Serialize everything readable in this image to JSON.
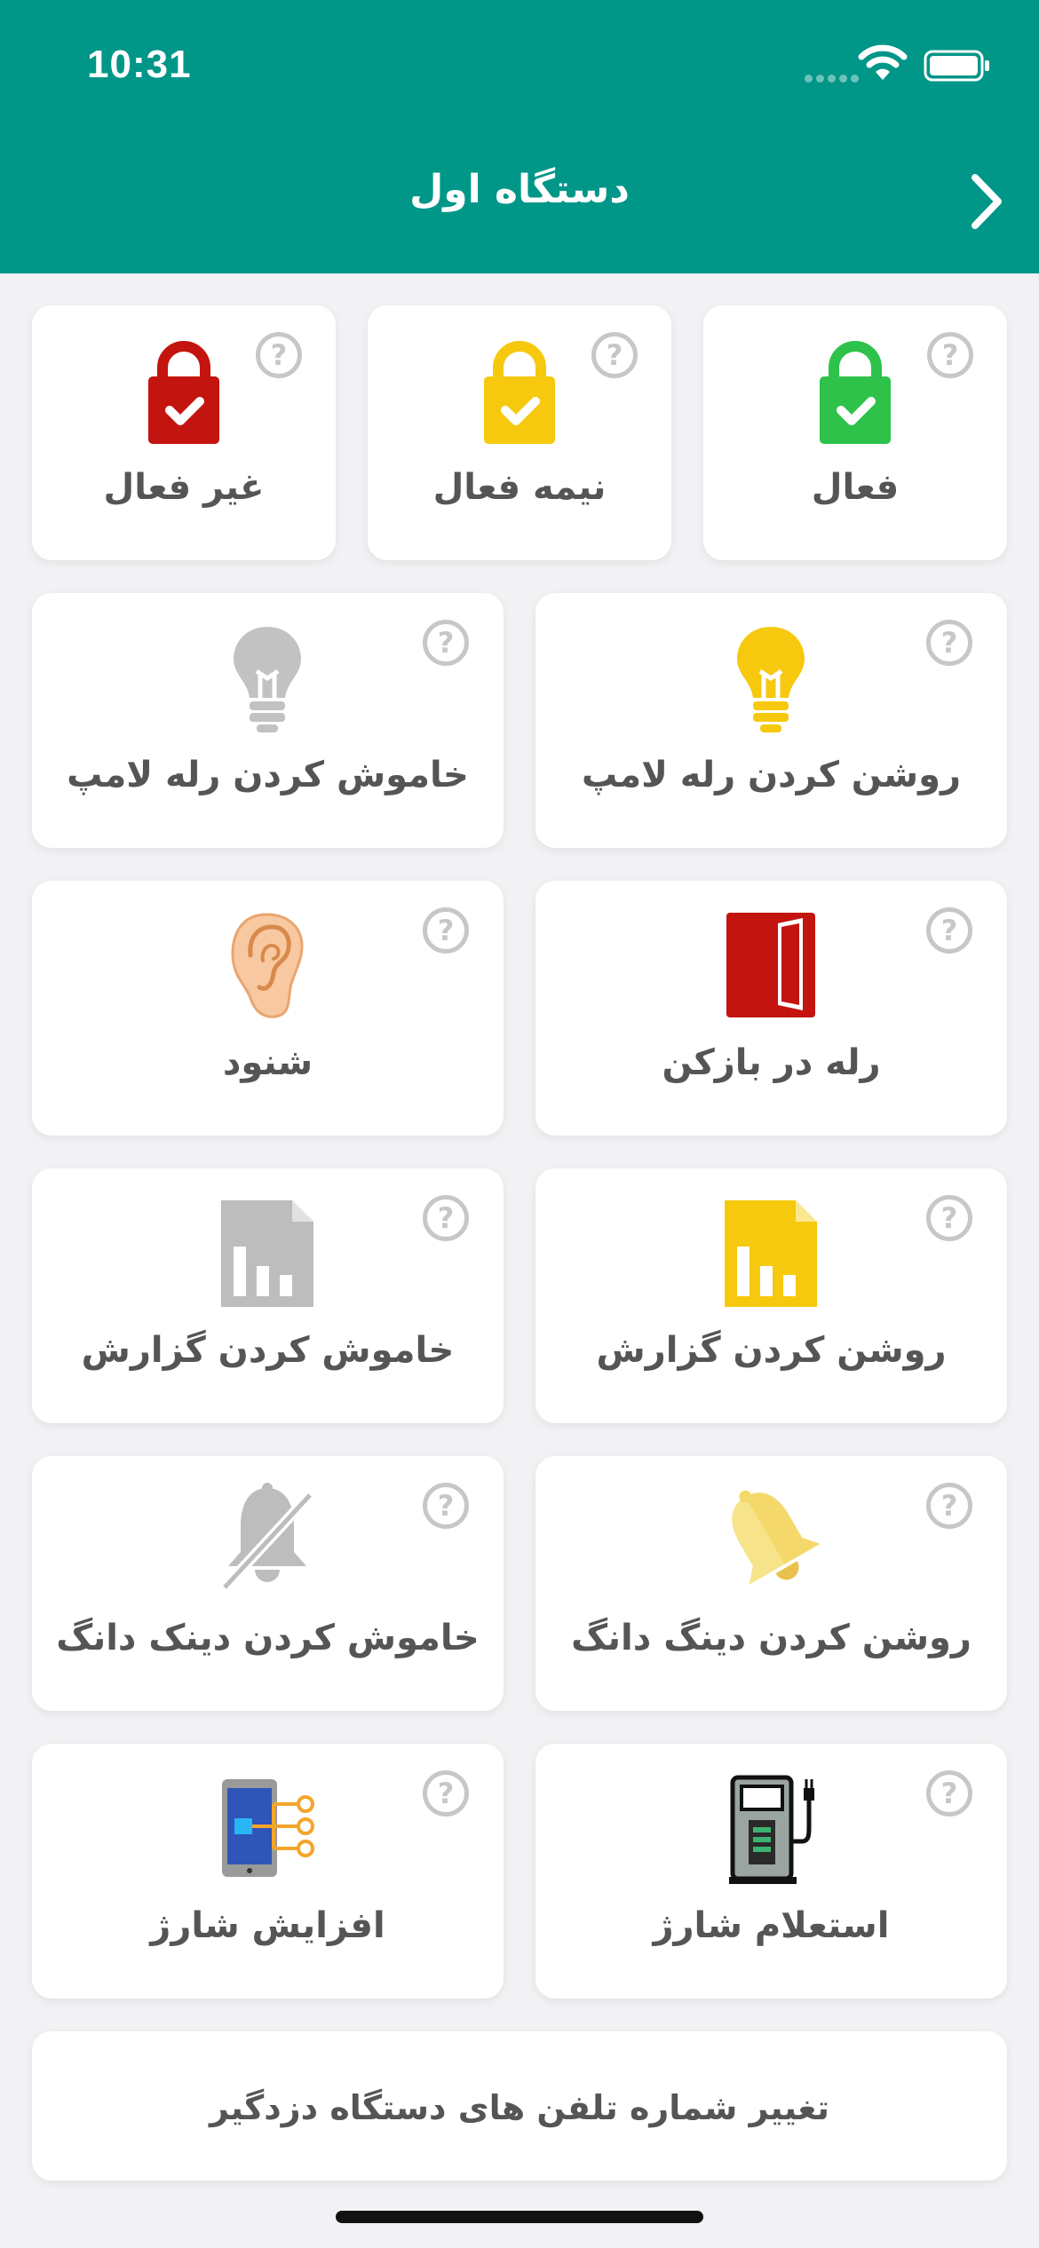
{
  "status": {
    "time": "10:31"
  },
  "header": {
    "title": "دستگاه اول"
  },
  "help_glyph": "?",
  "modes": [
    {
      "label": "فعال",
      "color": "#2ec24a"
    },
    {
      "label": "نیمه فعال",
      "color": "#f6c90e"
    },
    {
      "label": "غیر فعال",
      "color": "#c4140f"
    }
  ],
  "actions": [
    {
      "label": "روشن کردن رله لامپ",
      "icon": "lightbulb-on-icon"
    },
    {
      "label": "خاموش کردن رله لامپ",
      "icon": "lightbulb-off-icon"
    },
    {
      "label": "رله در بازکن",
      "icon": "door-icon"
    },
    {
      "label": "شنود",
      "icon": "ear-icon"
    },
    {
      "label": "روشن کردن گزارش",
      "icon": "report-on-icon"
    },
    {
      "label": "خاموش کردن گزارش",
      "icon": "report-off-icon"
    },
    {
      "label": "روشن کردن دینگ دانگ",
      "icon": "bell-on-icon"
    },
    {
      "label": "خاموش کردن دینک دانگ",
      "icon": "bell-off-icon"
    },
    {
      "label": "استعلام شارژ",
      "icon": "charge-station-icon"
    },
    {
      "label": "افزایش شارژ",
      "icon": "phone-network-icon"
    }
  ],
  "change_phone_button": {
    "label": "تغییر شماره تلفن های دستگاه دزدگیر"
  }
}
